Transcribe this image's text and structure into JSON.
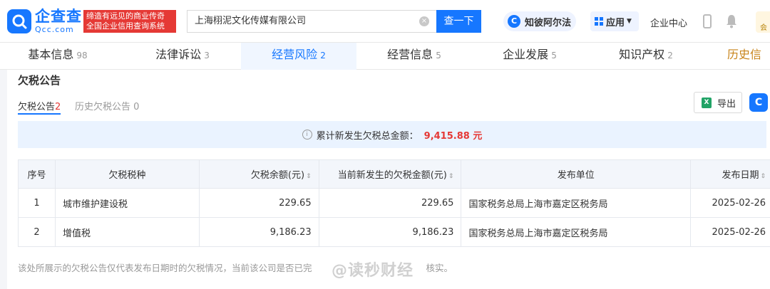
{
  "header": {
    "logo_cn": "企查查",
    "logo_en": "Qcc.com",
    "slogan_line1": "缔造有远见的商业传奇",
    "slogan_line2": "全国企业信用查询系统",
    "search_value": "上海栩泥文化传媒有限公司",
    "search_button": "查一下",
    "zhibi_label": "知彼阿尔法",
    "apps_label": "应用",
    "enterprise_center": "企业中心",
    "vip_label": "会"
  },
  "tabs": [
    {
      "label": "基本信息",
      "count": "98"
    },
    {
      "label": "法律诉讼",
      "count": "3"
    },
    {
      "label": "经营风险",
      "count": "2"
    },
    {
      "label": "经营信息",
      "count": "5"
    },
    {
      "label": "企业发展",
      "count": "5"
    },
    {
      "label": "知识产权",
      "count": "2"
    },
    {
      "label": "历史信息",
      "count": ""
    }
  ],
  "section": {
    "title": "欠税公告",
    "subtabs": [
      {
        "label": "欠税公告",
        "count": "2"
      },
      {
        "label": "历史欠税公告",
        "count": "0"
      }
    ],
    "export_label": "导出",
    "summary_label": "累计新发生欠税总金额：",
    "summary_value": "9,415.88 元"
  },
  "table": {
    "headers": [
      "序号",
      "欠税税种",
      "欠税余额(元)",
      "当前新发生的欠税金额(元)",
      "发布单位",
      "发布日期"
    ],
    "rows": [
      [
        "1",
        "城市维护建设税",
        "229.65",
        "229.65",
        "国家税务总局上海市嘉定区税务局",
        "2025-02-26"
      ],
      [
        "2",
        "增值税",
        "9,186.23",
        "9,186.23",
        "国家税务总局上海市嘉定区税务局",
        "2025-02-26"
      ]
    ]
  },
  "footnote": "该处所展示的欠税公告仅代表发布日期时的欠税情况，当前该公司是否已完",
  "footnote_tail": "核实。",
  "watermark": "@读秒财经",
  "colors": {
    "brand": "#1677ff",
    "accent_red": "#e53935",
    "history": "#c8841a"
  }
}
